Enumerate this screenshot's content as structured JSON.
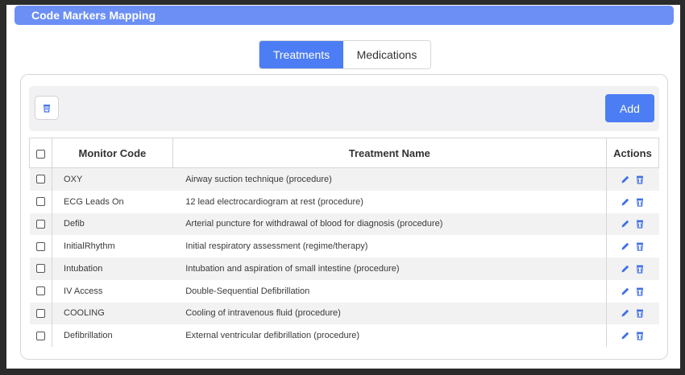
{
  "header": {
    "title": "Code Markers Mapping"
  },
  "tabs": [
    {
      "label": "Treatments",
      "active": true
    },
    {
      "label": "Medications",
      "active": false
    }
  ],
  "toolbar": {
    "add_label": "Add",
    "delete_icon": "trash-icon"
  },
  "table": {
    "columns": [
      "Monitor Code",
      "Treatment Name",
      "Actions"
    ],
    "rows": [
      {
        "code": "OXY",
        "name": "Airway suction technique (procedure)"
      },
      {
        "code": "ECG Leads On",
        "name": "12 lead electrocardiogram at rest (procedure)"
      },
      {
        "code": "Defib",
        "name": "Arterial puncture for withdrawal of blood for diagnosis (procedure)"
      },
      {
        "code": "InitialRhythm",
        "name": "Initial respiratory assessment (regime/therapy)"
      },
      {
        "code": "Intubation",
        "name": "Intubation and aspiration of small intestine (procedure)"
      },
      {
        "code": "IV Access",
        "name": "Double-Sequential Defibrillation"
      },
      {
        "code": "COOLING",
        "name": "Cooling of intravenous fluid (procedure)"
      },
      {
        "code": "Defibrillation",
        "name": "External ventricular defibrillation (procedure)"
      }
    ]
  },
  "colors": {
    "accent": "#4c7df5",
    "title_bar": "#6b8ff5",
    "icon": "#3f6fe8"
  }
}
